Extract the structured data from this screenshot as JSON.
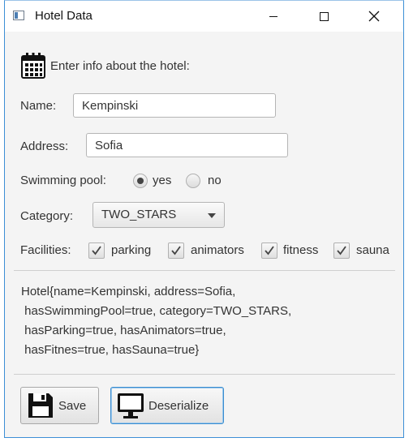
{
  "window": {
    "title": "Hotel Data",
    "minimize_symbol": "—",
    "maximize_symbol": "☐",
    "close_symbol": "✕"
  },
  "form": {
    "header": "Enter info about the hotel:",
    "header_icon": "calendar-icon",
    "name": {
      "label": "Name:",
      "value": "Kempinski"
    },
    "address": {
      "label": "Address:",
      "value": "Sofia"
    },
    "swimming_pool": {
      "label": "Swimming pool:",
      "options": [
        {
          "label": "yes",
          "selected": true
        },
        {
          "label": "no",
          "selected": false
        }
      ]
    },
    "category": {
      "label": "Category:",
      "value": "TWO_STARS"
    },
    "facilities": {
      "label": "Facilities:",
      "items": [
        {
          "label": "parking",
          "checked": true
        },
        {
          "label": "animators",
          "checked": true
        },
        {
          "label": "fitness",
          "checked": true
        },
        {
          "label": "sauna",
          "checked": true
        }
      ]
    }
  },
  "output": {
    "lines": [
      "Hotel{name=Kempinski, address=Sofia,",
      " hasSwimmingPool=true, category=TWO_STARS,",
      " hasParking=true, hasAnimators=true,",
      " hasFitnes=true, hasSauna=true}"
    ]
  },
  "buttons": {
    "save": {
      "label": "Save",
      "icon": "floppy-disk-icon"
    },
    "deserialize": {
      "label": "Deserialize",
      "icon": "monitor-icon"
    }
  },
  "colors": {
    "window_border": "#3c8fd6",
    "focus_border": "#3a8dd0",
    "background": "#f4f4f4"
  }
}
